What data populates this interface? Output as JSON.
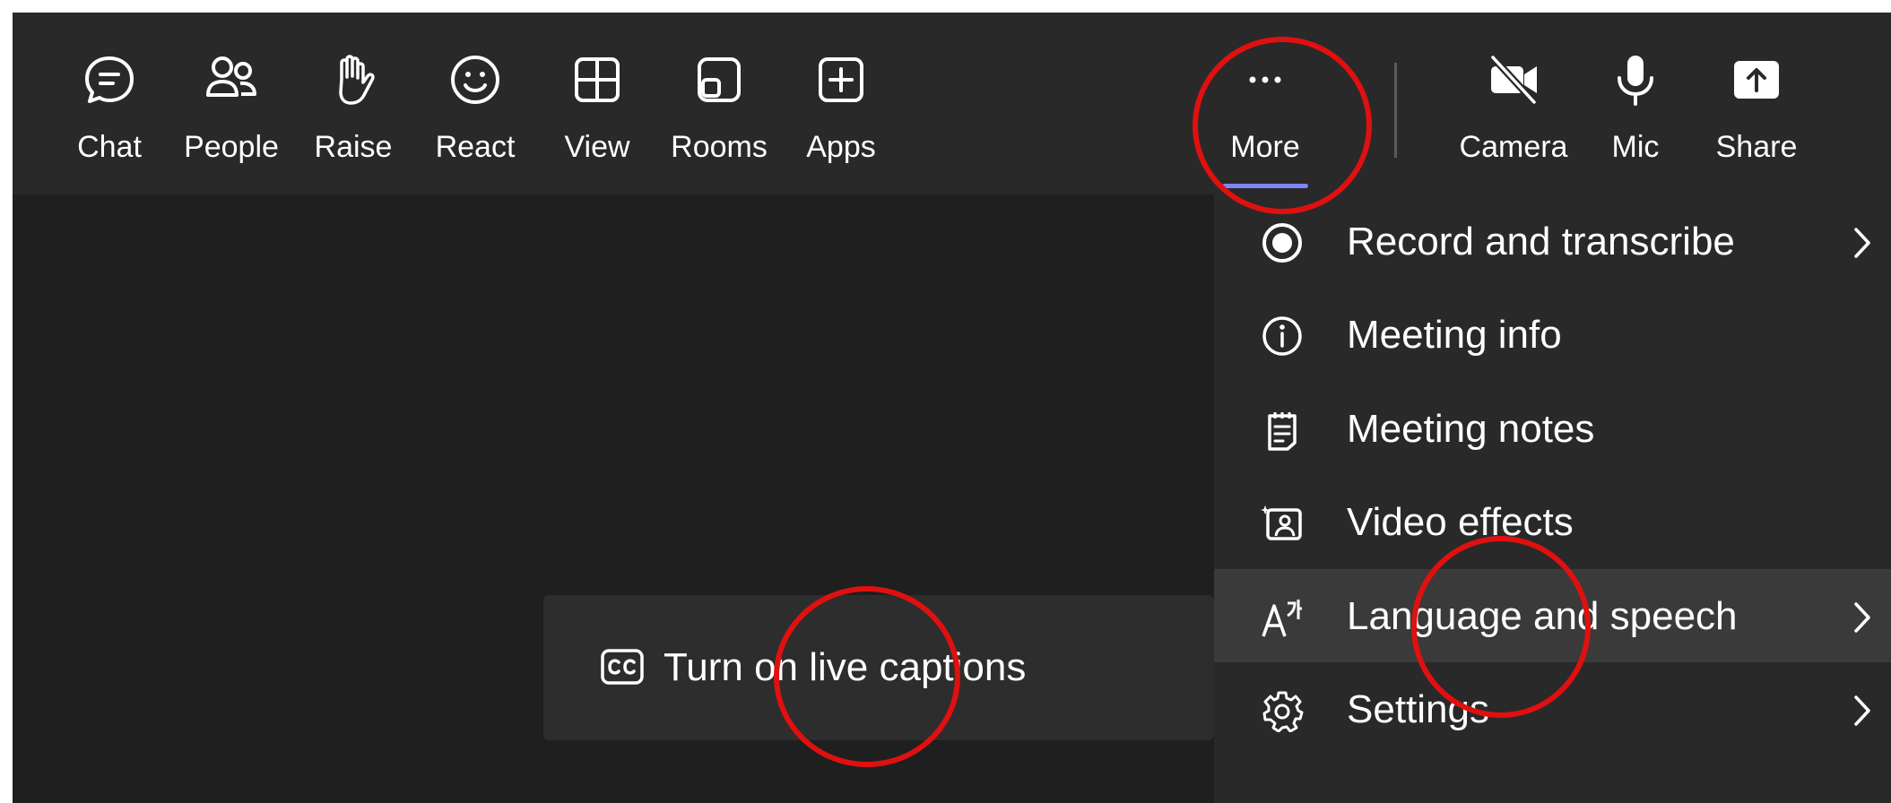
{
  "toolbar": {
    "items": [
      {
        "label": "Chat",
        "icon": "chat-icon"
      },
      {
        "label": "People",
        "icon": "people-icon"
      },
      {
        "label": "Raise",
        "icon": "hand-icon"
      },
      {
        "label": "React",
        "icon": "smiley-icon"
      },
      {
        "label": "View",
        "icon": "grid-icon"
      },
      {
        "label": "Rooms",
        "icon": "rooms-icon"
      },
      {
        "label": "Apps",
        "icon": "plus-box-icon"
      },
      {
        "label": "More",
        "icon": "ellipsis-icon"
      },
      {
        "label": "Camera",
        "icon": "camera-off-icon"
      },
      {
        "label": "Mic",
        "icon": "mic-icon"
      },
      {
        "label": "Share",
        "icon": "share-icon"
      }
    ],
    "active": "More"
  },
  "more_menu": {
    "items": [
      {
        "label": "Record and transcribe",
        "icon": "record-icon",
        "has_submenu": true
      },
      {
        "label": "Meeting info",
        "icon": "info-icon",
        "has_submenu": false
      },
      {
        "label": "Meeting notes",
        "icon": "notes-icon",
        "has_submenu": false
      },
      {
        "label": "Video effects",
        "icon": "video-effects-icon",
        "has_submenu": false
      },
      {
        "label": "Language and speech",
        "icon": "language-icon",
        "has_submenu": true,
        "highlighted": true
      },
      {
        "label": "Settings",
        "icon": "gear-icon",
        "has_submenu": true
      }
    ]
  },
  "captions_submenu": {
    "items": [
      {
        "label": "Turn on live captions",
        "icon": "cc-icon"
      }
    ]
  },
  "colors": {
    "background": "#1f1f1f",
    "toolbar": "#292929",
    "accent": "#7f85f5",
    "annotation": "#e01010"
  }
}
